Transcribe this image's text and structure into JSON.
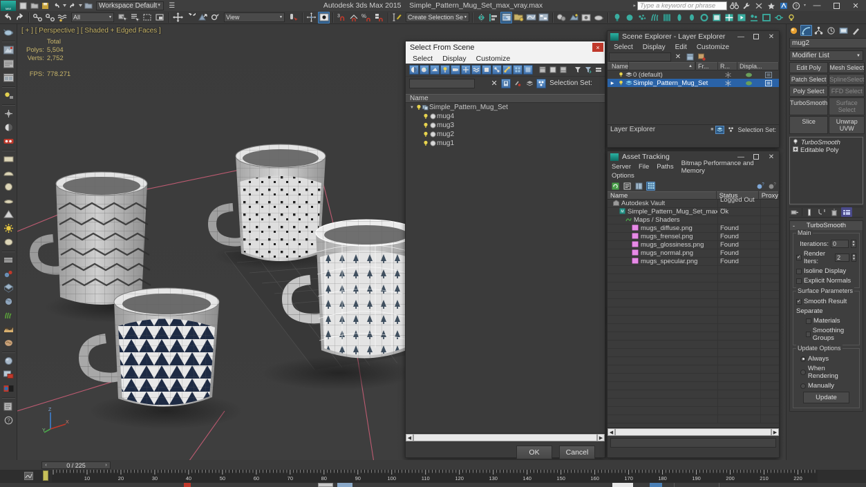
{
  "titlebar": {
    "app_title": "Autodesk 3ds Max  2015",
    "file_name": "Simple_Pattern_Mug_Set_max_vray.max",
    "workspace": "Workspace Default",
    "search_placeholder": "Type a keyword or phrase",
    "minimize": "—",
    "maximize": "❐",
    "close": "✕"
  },
  "maintoolbar": {
    "selection_filter": "All",
    "reference_coord": "View",
    "named_selection_set": "Create Selection Se"
  },
  "viewport": {
    "label": "[ + ] [ Perspective ] [ Shaded + Edged Faces ]",
    "stats": {
      "col_header": "Total",
      "polys_label": "Polys:",
      "polys_value": "5,504",
      "verts_label": "Verts:",
      "verts_value": "2,752",
      "fps_label": "FPS:",
      "fps_value": "778.271"
    },
    "axis": {
      "z": "Z",
      "x": "X",
      "y": "Y"
    }
  },
  "select_from_scene": {
    "title": "Select From Scene",
    "close": "×",
    "menu": [
      "Select",
      "Display",
      "Customize"
    ],
    "selection_set_label": "Selection Set:",
    "column_header": "Name",
    "tree": [
      {
        "label": "Simple_Pattern_Mug_Set",
        "depth": 0,
        "type": "group",
        "expanded": true
      },
      {
        "label": "mug4",
        "depth": 1,
        "type": "object"
      },
      {
        "label": "mug3",
        "depth": 1,
        "type": "object"
      },
      {
        "label": "mug2",
        "depth": 1,
        "type": "object"
      },
      {
        "label": "mug1",
        "depth": 1,
        "type": "object"
      }
    ],
    "ok_label": "OK",
    "cancel_label": "Cancel"
  },
  "scene_explorer": {
    "title": "Scene Explorer - Layer Explorer",
    "minimize": "—",
    "maximize": "❐",
    "close": "✕",
    "menu": [
      "Select",
      "Display",
      "Edit",
      "Customize"
    ],
    "columns": [
      "Name",
      "Fr...",
      "R...",
      "Displa..."
    ],
    "sort_indicator": "▲",
    "rows": [
      {
        "name": "0 (default)",
        "selected": false,
        "expandable": false
      },
      {
        "name": "Simple_Pattern_Mug_Set",
        "selected": true,
        "expandable": true
      }
    ],
    "footer_label": "Layer Explorer",
    "footer_selection_set": "Selection Set:"
  },
  "asset_tracking": {
    "title": "Asset Tracking",
    "minimize": "—",
    "maximize": "❐",
    "close": "✕",
    "menu": [
      "Server",
      "File",
      "Paths",
      "Bitmap Performance and Memory",
      "Options"
    ],
    "columns": [
      "Name",
      "Status",
      "Proxy"
    ],
    "rows": [
      {
        "name": "Autodesk Vault",
        "status": "Logged Out ...",
        "depth": 0,
        "icon": "vault-icon"
      },
      {
        "name": "Simple_Pattern_Mug_Set_max_v...",
        "status": "Ok",
        "depth": 1,
        "icon": "max-file-icon"
      },
      {
        "name": "Maps / Shaders",
        "status": "",
        "depth": 2,
        "icon": "maps-icon"
      },
      {
        "name": "mugs_diffuse.png",
        "status": "Found",
        "depth": 3,
        "icon": "bitmap-icon"
      },
      {
        "name": "mugs_frensel.png",
        "status": "Found",
        "depth": 3,
        "icon": "bitmap-icon"
      },
      {
        "name": "mugs_glossiness.png",
        "status": "Found",
        "depth": 3,
        "icon": "bitmap-icon"
      },
      {
        "name": "mugs_normal.png",
        "status": "Found",
        "depth": 3,
        "icon": "bitmap-icon"
      },
      {
        "name": "mugs_specular.png",
        "status": "Found",
        "depth": 3,
        "icon": "bitmap-icon"
      }
    ],
    "empty_row_count": 19
  },
  "command_panel": {
    "object_name": "mug2",
    "modifier_list_label": "Modifier List",
    "modifier_buttons": [
      {
        "label": "Edit Poly",
        "dim": false
      },
      {
        "label": "Mesh Select",
        "dim": false
      },
      {
        "label": "Patch Select",
        "dim": false
      },
      {
        "label": "SplineSelect",
        "dim": true
      },
      {
        "label": "Poly Select",
        "dim": false
      },
      {
        "label": "FFD Select",
        "dim": true
      },
      {
        "label": "TurboSmooth",
        "dim": false
      },
      {
        "label": "Surface Select",
        "dim": true
      },
      {
        "label": "Slice",
        "dim": false
      },
      {
        "label": "Unwrap UVW",
        "dim": false
      }
    ],
    "stack": [
      {
        "label": "TurboSmooth",
        "italic": true,
        "icon": "lightbulb-icon"
      },
      {
        "label": "Editable Poly",
        "italic": false,
        "icon": "plus-box-icon"
      }
    ],
    "rollout": {
      "title": "TurboSmooth",
      "collapse_glyph": "-",
      "main_group": "Main",
      "iterations_label": "Iterations:",
      "iterations_value": "0",
      "render_iters_label": "Render Iters:",
      "render_iters_value": "2",
      "render_iters_checked": true,
      "isoline_display_label": "Isoline Display",
      "isoline_display_checked": false,
      "explicit_normals_label": "Explicit Normals",
      "explicit_normals_checked": false,
      "surface_params_group": "Surface Parameters",
      "smooth_result_label": "Smooth Result",
      "smooth_result_checked": true,
      "separate_label": "Separate",
      "materials_label": "Materials",
      "materials_checked": false,
      "smoothing_groups_label": "Smoothing Groups",
      "smoothing_groups_checked": false,
      "update_options_group": "Update Options",
      "always_label": "Always",
      "when_rendering_label": "When Rendering",
      "manually_label": "Manually",
      "update_mode": "Always",
      "update_button_label": "Update"
    }
  },
  "timeline": {
    "current_frame": "0 / 225",
    "prev_glyph": "‹",
    "next_glyph": "›",
    "ticks": [
      10,
      20,
      30,
      40,
      50,
      60,
      70,
      80,
      90,
      100,
      110,
      120,
      130,
      140,
      150,
      160,
      170,
      180,
      190,
      200,
      210,
      220
    ],
    "range_start": 0,
    "range_end": 225
  },
  "colors": {
    "accent_blue": "#2a63a8",
    "viewport_bg": "#3c3c3c",
    "panel_bg": "#3b3b3b",
    "stats_yellow": "#c8b56a",
    "key_yellow": "#c8c05a"
  }
}
